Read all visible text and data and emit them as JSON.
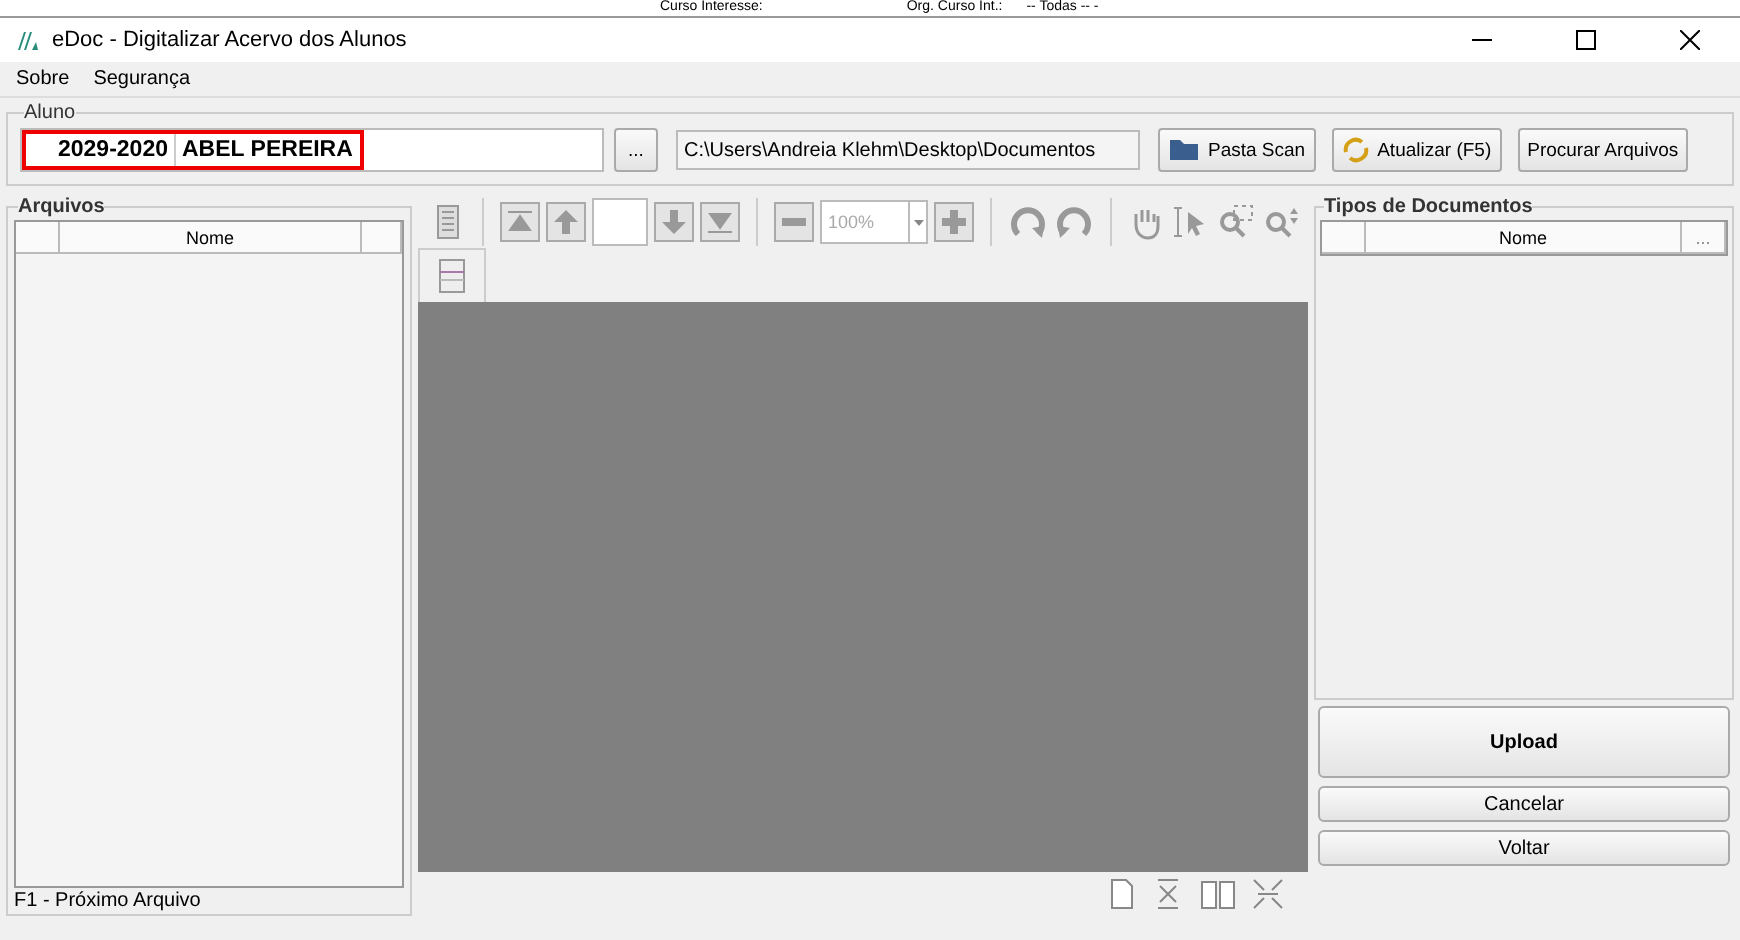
{
  "background_window": {
    "field_label_1": "Curso Interesse:",
    "field_label_2": "Org. Curso Int.:",
    "field_value_2": "-- Todas -- -"
  },
  "window": {
    "title": "eDoc - Digitalizar Acervo dos Alunos"
  },
  "menu": [
    "Sobre",
    "Segurança"
  ],
  "aluno": {
    "label": "Aluno",
    "code": "2029-2020",
    "name": "ABEL PEREIRA",
    "browse": "...",
    "path": "C:\\Users\\Andreia Klehm\\Desktop\\Documentos",
    "buttons": [
      {
        "kind": "folder",
        "label": "Pasta Scan"
      },
      {
        "kind": "refresh",
        "label": "Atualizar (F5)"
      },
      {
        "kind": "plain",
        "label": "Procurar Arquivos"
      }
    ]
  },
  "arquivos": {
    "label": "Arquivos",
    "columns": [
      "",
      "Nome",
      ""
    ],
    "hint": "F1 - Próximo Arquivo"
  },
  "viewer": {
    "zoom": "100%"
  },
  "tipos": {
    "label": "Tipos de Documentos",
    "columns": [
      "",
      "Nome",
      "..."
    ]
  },
  "actions": [
    {
      "kind": "primary",
      "label": "Upload"
    },
    {
      "kind": "normal",
      "label": "Cancelar"
    },
    {
      "kind": "normal",
      "label": "Voltar"
    }
  ]
}
